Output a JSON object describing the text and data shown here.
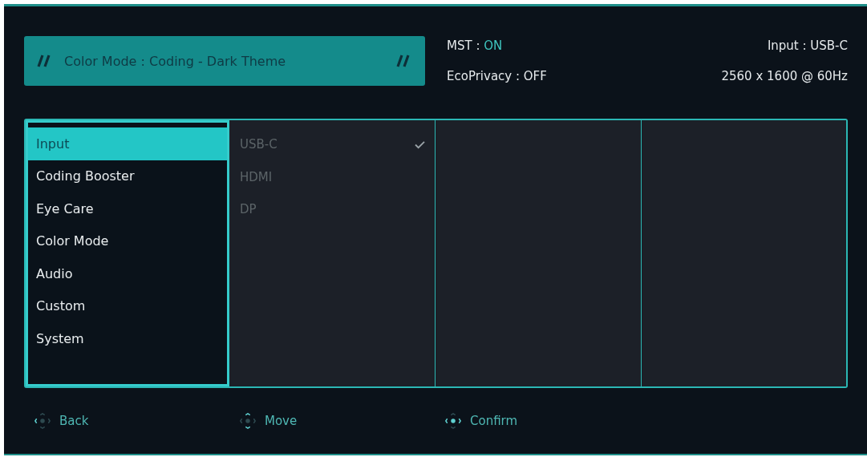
{
  "banner": {
    "text": "Color Mode : Coding - Dark Theme"
  },
  "status": [
    {
      "label": "MST :",
      "value": "ON",
      "on": true
    },
    {
      "label": "EcoPrivacy :",
      "value": "OFF",
      "on": false
    }
  ],
  "info": [
    {
      "text": "Input : USB-C"
    },
    {
      "text": "2560 x 1600 @ 60Hz"
    }
  ],
  "menu": [
    {
      "label": "Input",
      "selected": true
    },
    {
      "label": "Coding Booster",
      "selected": false
    },
    {
      "label": "Eye Care",
      "selected": false
    },
    {
      "label": "Color Mode",
      "selected": false
    },
    {
      "label": "Audio",
      "selected": false
    },
    {
      "label": "Custom",
      "selected": false
    },
    {
      "label": "System",
      "selected": false
    }
  ],
  "submenu": [
    {
      "label": "USB-C",
      "checked": true
    },
    {
      "label": "HDMI",
      "checked": false
    },
    {
      "label": "DP",
      "checked": false
    }
  ],
  "hints": [
    {
      "kind": "back",
      "label": "Back"
    },
    {
      "kind": "move",
      "label": "Move"
    },
    {
      "kind": "confirm",
      "label": "Confirm"
    }
  ]
}
